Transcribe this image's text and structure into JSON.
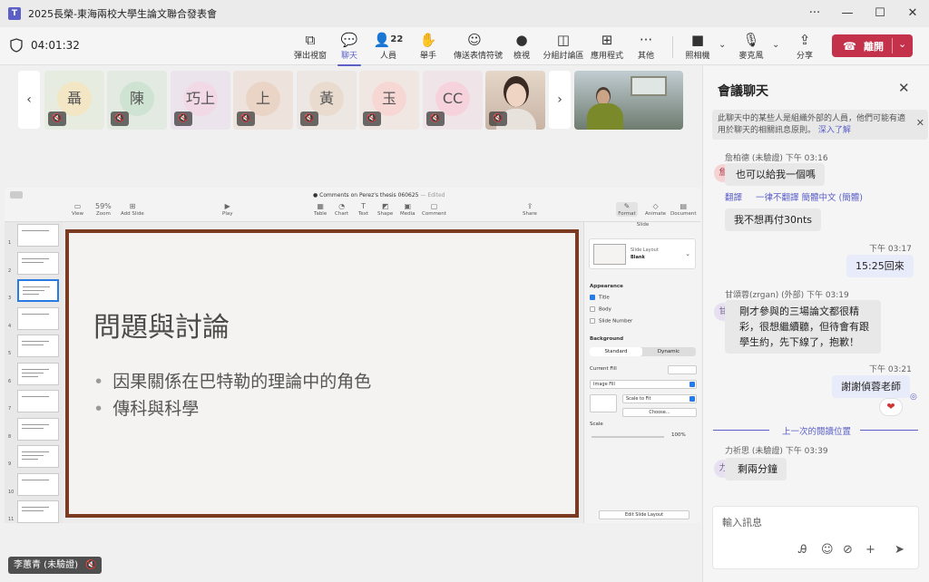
{
  "window": {
    "title": "2025長榮-東海兩校大學生論文聯合發表會",
    "controls": [
      "···",
      "—",
      "☐",
      "✕"
    ]
  },
  "toolbar": {
    "timer": "04:01:32",
    "items": [
      {
        "label": "彈出視窗",
        "icon": "popout-icon"
      },
      {
        "label": "聊天",
        "icon": "chat-icon"
      },
      {
        "label": "人員",
        "icon": "people-icon",
        "badge": "22"
      },
      {
        "label": "舉手",
        "icon": "raise-hand-icon"
      },
      {
        "label": "傳送表情符號",
        "icon": "emoji-icon"
      },
      {
        "label": "檢視",
        "icon": "view-icon"
      },
      {
        "label": "分組討論區",
        "icon": "breakout-rooms-icon"
      },
      {
        "label": "應用程式",
        "icon": "apps-icon"
      },
      {
        "label": "其他",
        "icon": "more-icon"
      },
      {
        "label": "照相機",
        "icon": "camera-icon"
      },
      {
        "label": "麥克風",
        "icon": "microphone-off-icon"
      },
      {
        "label": "分享",
        "icon": "share-icon"
      }
    ],
    "leave_label": "離開"
  },
  "gallery": {
    "tiles": [
      {
        "initial": "聶",
        "bg": "#e6ecdf",
        "av": "#f3e6c5"
      },
      {
        "initial": "陳",
        "bg": "#e2eae2",
        "av": "#cfe3d2"
      },
      {
        "initial": "巧上",
        "bg": "#ece4ec",
        "av": "#f2d9e6"
      },
      {
        "initial": "上",
        "bg": "#ede3dc",
        "av": "#ead4c6"
      },
      {
        "initial": "黃",
        "bg": "#ece7e2",
        "av": "#e9dccf"
      },
      {
        "initial": "玉",
        "bg": "#f0e7e2",
        "av": "#f7d7d4"
      },
      {
        "initial": "CC",
        "bg": "#efe4e7",
        "av": "#f6d3dc"
      }
    ]
  },
  "keynote": {
    "doc_title": "Comments on Perez's thesis 060625",
    "edited": "— Edited",
    "zoom": "59%",
    "toolbar_left": [
      "View",
      "Zoom",
      "Add Slide"
    ],
    "play": "Play",
    "toolbar_mid": [
      "Table",
      "Chart",
      "Text",
      "Shape",
      "Media",
      "Comment"
    ],
    "share": "Share",
    "toolbar_right": [
      "Format",
      "Animate",
      "Document"
    ],
    "thumb_numbers": [
      "1",
      "2",
      "3",
      "4",
      "5",
      "6",
      "7",
      "8",
      "9",
      "10",
      "11"
    ],
    "slide_title": "問題與討論",
    "bullets": [
      "因果關係在巴特勒的理論中的角色",
      "傳科與科學"
    ],
    "inspector": {
      "header": "Slide",
      "layout_label": "Slide Layout",
      "layout_value": "Blank",
      "appearance": "Appearance",
      "title": "Title",
      "body": "Body",
      "slide_number": "Slide Number",
      "background": "Background",
      "standard": "Standard",
      "dynamic": "Dynamic",
      "current_fill": "Current Fill",
      "image_fill": "Image Fill",
      "scale_to_fit": "Scale to Fit",
      "choose": "Choose...",
      "scale": "Scale",
      "scale_value": "100%",
      "edit_layout": "Edit Slide Layout"
    }
  },
  "presenter_tag": "李蕙青 (未驗證)",
  "chat": {
    "title": "會議聊天",
    "notice": "此聊天中的某些人是組織外部的人員，他們可能有適用於聊天的相關訊息原則。",
    "notice_link": "深入了解",
    "messages": [
      {
        "meta": "詹柏德 (未驗證)  下午 03:16",
        "avatar": "詹",
        "text": "也可以給我一個嗎"
      },
      {
        "translate": "翻譯",
        "never_translate": "一律不翻譯 簡體中文 (簡體)"
      },
      {
        "text": "我不想再付30nts"
      },
      {
        "meta": "下午 03:17",
        "text": "15:25回來",
        "mine": true
      },
      {
        "meta": "甘頌蓉(zrgan) (外部)  下午 03:19",
        "avatar": "甘",
        "text": "剛才參與的三場論文都很精彩，很想繼續聽，但待會有跟學生約，先下線了，抱歉！"
      },
      {
        "meta": "下午 03:21",
        "text": "謝謝偵蓉老師",
        "mine": true
      },
      {
        "meta": "力祈思 (未驗證)  下午 03:39",
        "avatar": "力",
        "text": "剩兩分鐘"
      }
    ],
    "last_read": "上一次的閱讀位置",
    "compose_placeholder": "輸入訊息"
  }
}
